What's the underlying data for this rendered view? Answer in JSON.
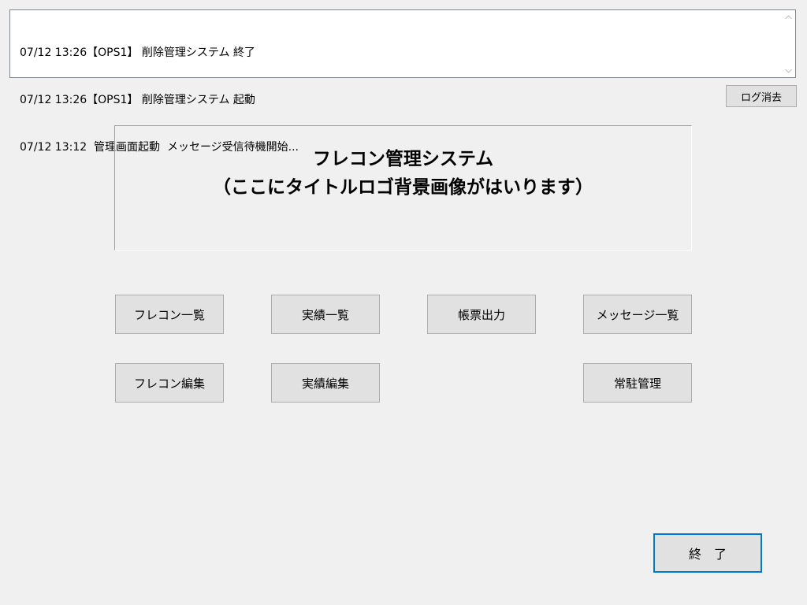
{
  "log": {
    "lines": [
      "07/12 13:26【OPS1】 削除管理システム 終了",
      "07/12 13:26【OPS1】 削除管理システム 起動",
      "07/12 13:12  管理画面起動  メッセージ受信待機開始..."
    ]
  },
  "log_clear_button": {
    "label": "ログ消去"
  },
  "title": {
    "line1": "フレコン管理システム",
    "line2": "（ここにタイトルロゴ背景画像がはいります）"
  },
  "menu": {
    "flecon_list": "フレコン一覧",
    "results_list": "実績一覧",
    "report_output": "帳票出力",
    "message_list": "メッセージ一覧",
    "flecon_edit": "フレコン編集",
    "results_edit": "実績編集",
    "resident_management": "常駐管理"
  },
  "exit_button": {
    "label": "終　了"
  },
  "icons": {
    "scroll_up": "chevron-up-icon",
    "scroll_down": "chevron-down-icon"
  }
}
